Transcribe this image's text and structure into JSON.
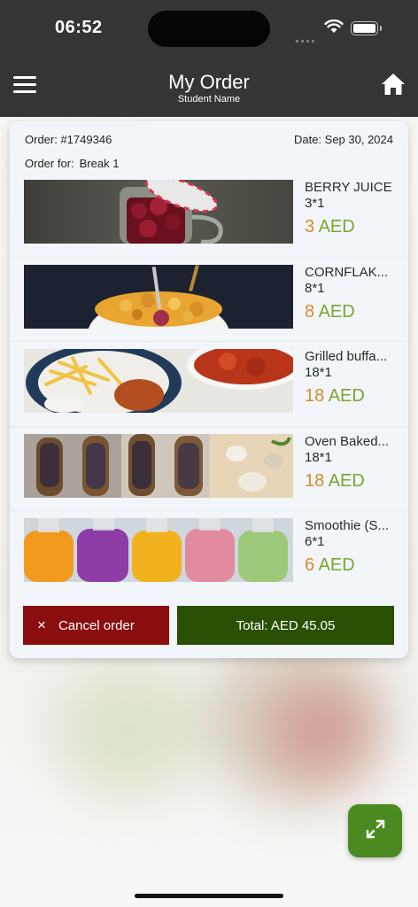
{
  "status_bar": {
    "time": "06:52"
  },
  "header": {
    "title": "My Order",
    "subtitle": "Student Name"
  },
  "order": {
    "number": "Order: #1749346",
    "date": "Date: Sep 30, 2024",
    "for_label": "Order for:",
    "for_value": "Break 1"
  },
  "items": [
    {
      "name": "BERRY JUICE",
      "qty": "3*1",
      "price": "3",
      "currency": "AED"
    },
    {
      "name": "CORNFLAK...",
      "qty": "8*1",
      "price": "8",
      "currency": "AED"
    },
    {
      "name": "Grilled buffa...",
      "qty": "18*1",
      "price": "18",
      "currency": "AED"
    },
    {
      "name": "Oven Baked...",
      "qty": "18*1",
      "price": "18",
      "currency": "AED"
    },
    {
      "name": "Smoothie (S...",
      "qty": "6*1",
      "price": "6",
      "currency": "AED"
    }
  ],
  "actions": {
    "cancel_icon": "×",
    "cancel_label": "Cancel order",
    "total_label": "Total: AED 45.05"
  },
  "icons": {
    "menu": "hamburger-menu-icon",
    "home": "home-icon",
    "cancel": "close-icon",
    "expand": "expand-arrows-icon"
  },
  "colors": {
    "header_bg": "#353535",
    "price_number": "#d98a2b",
    "price_currency": "#7ba52d",
    "cancel_bg": "#8a0e0e",
    "total_bg": "#295004",
    "fab_bg": "#4b8a20"
  }
}
